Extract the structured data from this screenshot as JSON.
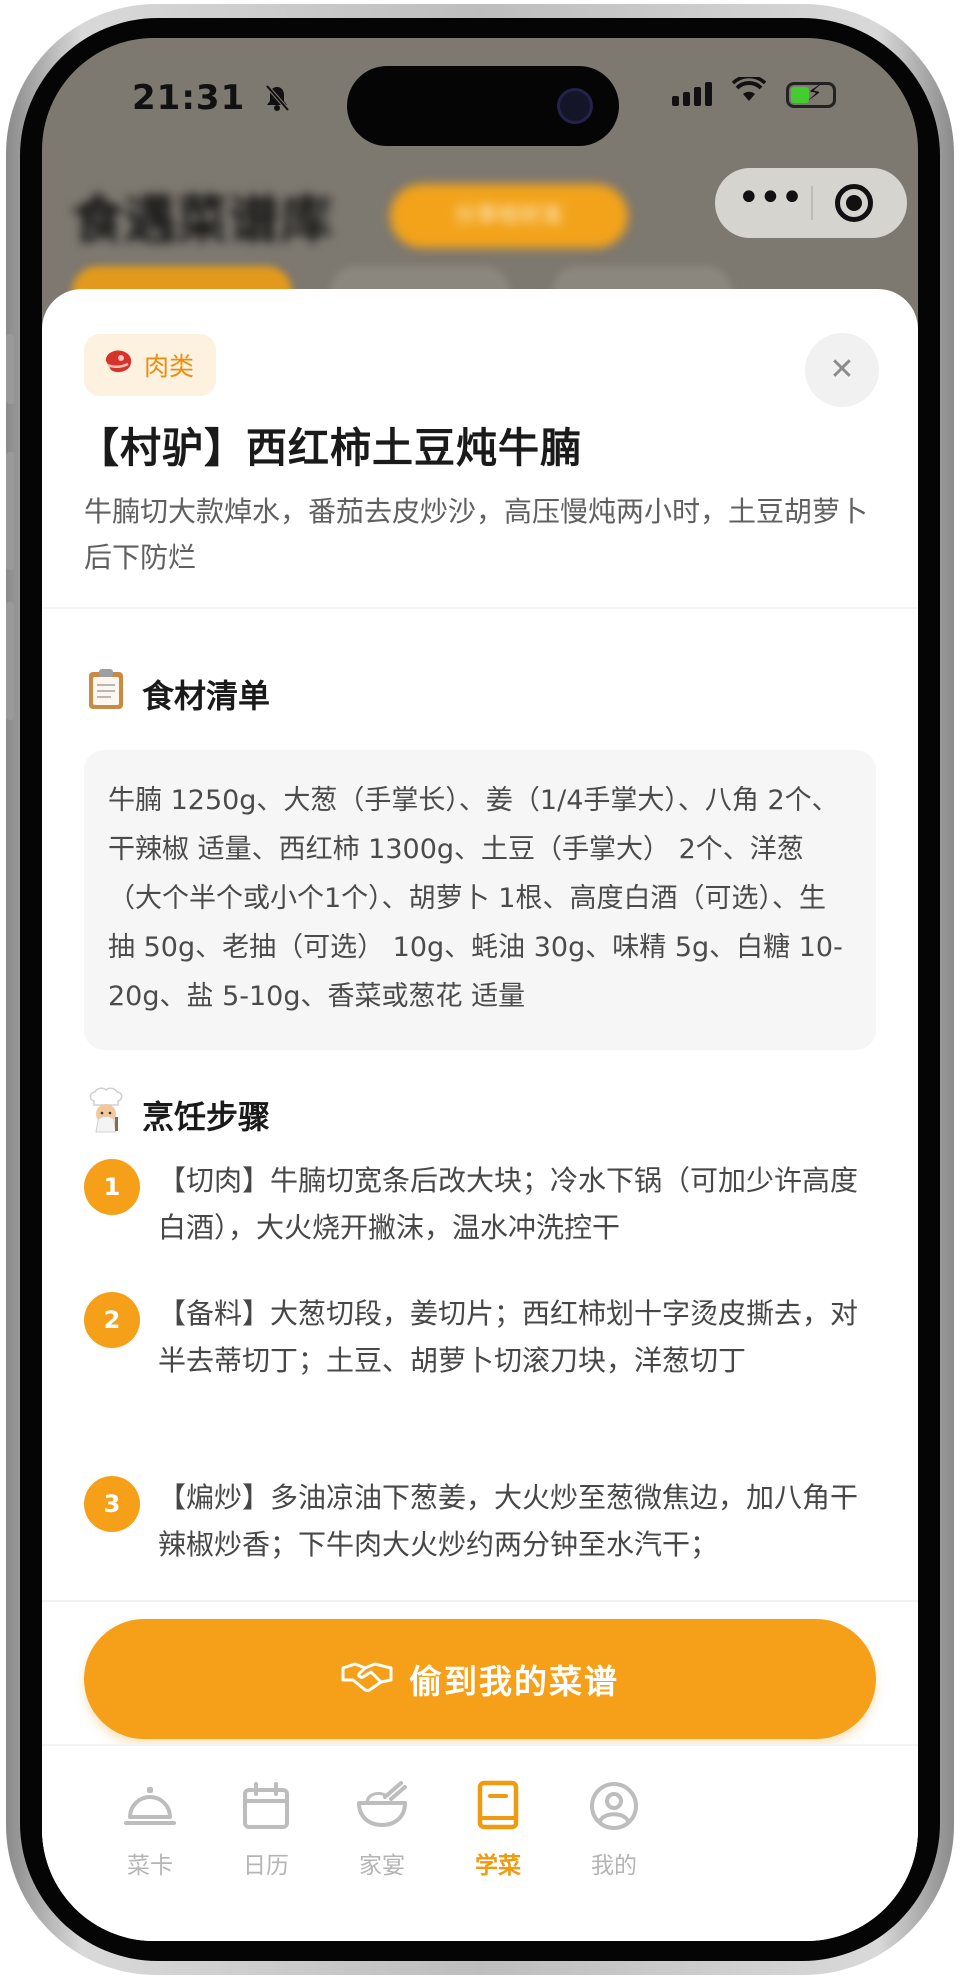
{
  "status_bar": {
    "time": "21:31"
  },
  "background_page": {
    "title": "食遇菜谱库",
    "share_button": "分享给好友"
  },
  "sheet": {
    "category_badge": "肉类",
    "title": "【村驴】西红柿土豆炖牛腩",
    "description": "牛腩切大款焯水，番茄去皮炒沙，高压慢炖两小时，土豆胡萝卜后下防烂",
    "ingredients_section": {
      "icon": "clipboard-icon",
      "title": "食材清单",
      "text": "牛腩 1250g、大葱（手掌长）、姜（1/4手掌大）、八角 2个、干辣椒 适量、西红柿 1300g、土豆（手掌大） 2个、洋葱（大个半个或小个1个）、胡萝卜 1根、高度白酒（可选）、生抽 50g、老抽（可选） 10g、蚝油 30g、味精 5g、白糖 10-20g、盐 5-10g、香菜或葱花 适量"
    },
    "steps_section": {
      "icon": "cook-icon",
      "title": "烹饪步骤",
      "steps": [
        {
          "number": "1",
          "text": "【切肉】牛腩切宽条后改大块；冷水下锅（可加少许高度白酒），大火烧开撇沫，温水冲洗控干"
        },
        {
          "number": "2",
          "text": "【备料】大葱切段，姜切片；西红柿划十字烫皮撕去，对半去蒂切丁；土豆、胡萝卜切滚刀块，洋葱切丁"
        },
        {
          "number": "3",
          "text": "【煸炒】多油凉油下葱姜，大火炒至葱微焦边，加八角干辣椒炒香；下牛肉大火炒约两分钟至水汽干；"
        }
      ]
    },
    "steal_button": "偷到我的菜谱"
  },
  "tabbar": {
    "items": [
      {
        "label": "菜卡",
        "icon": "cloche-icon"
      },
      {
        "label": "日历",
        "icon": "calendar-icon"
      },
      {
        "label": "家宴",
        "icon": "bowl-icon"
      },
      {
        "label": "学菜",
        "icon": "book-icon"
      },
      {
        "label": "我的",
        "icon": "profile-icon"
      }
    ],
    "active": "学菜"
  },
  "colors": {
    "accent": "#f6a01a",
    "badge_bg": "#fdf1df",
    "badge_text": "#ea8f0f",
    "tab_inactive": "#b5b5b5"
  }
}
